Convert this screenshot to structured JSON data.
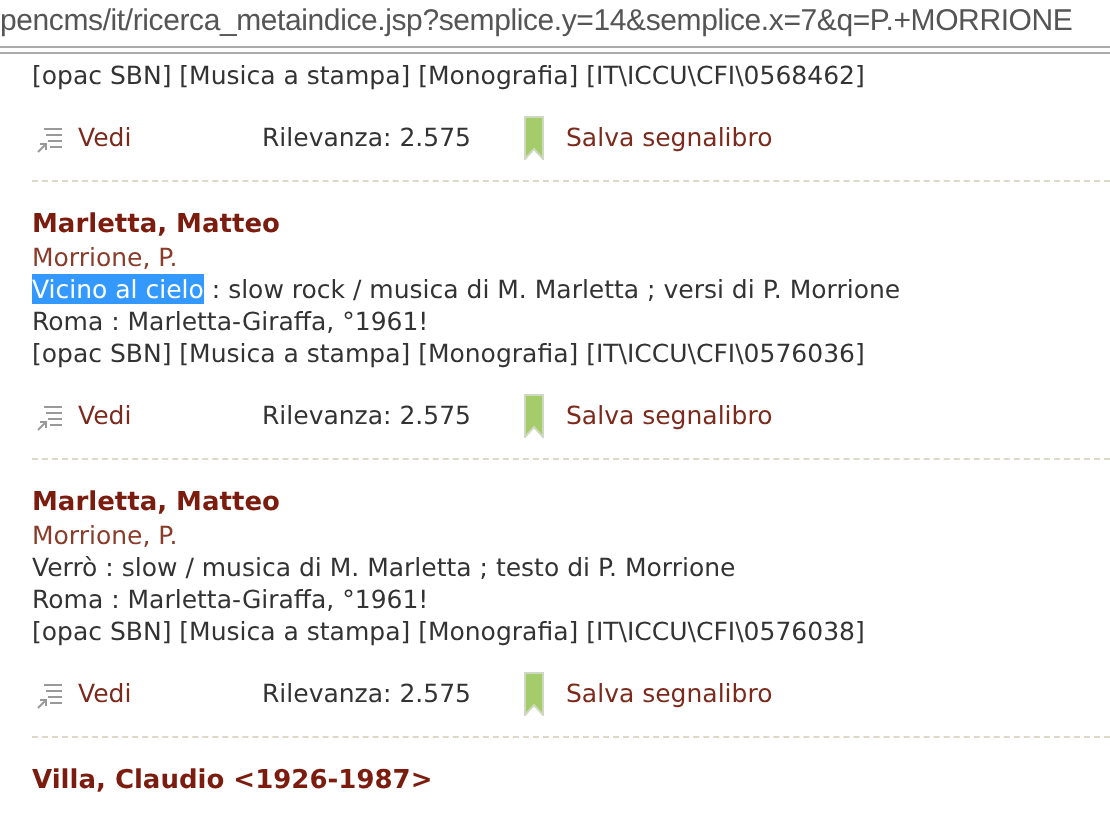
{
  "address_bar": {
    "url": "pencms/it/ricerca_metaindice.jsp?semplice.y=14&semplice.x=7&q=P.+MORRIONE"
  },
  "records": [
    {
      "tags": "[opac SBN] [Musica a stampa] [Monografia] [IT\\ICCU\\CFI\\0568462]",
      "view": "Vedi",
      "relevance": "Rilevanza: 2.575",
      "bookmark": "Salva segnalibro"
    },
    {
      "author": "Marletta, Matteo",
      "co_author": "Morrione, P.",
      "title": [
        {
          "text": "Vicino al cielo",
          "selected": true
        },
        {
          "text": " : slow rock / musica di M. Marletta ; versi di P. Morrione",
          "selected": false
        }
      ],
      "imprint": "Roma : Marletta-Giraffa, °1961!",
      "tags": "[opac SBN] [Musica a stampa] [Monografia] [IT\\ICCU\\CFI\\0576036]",
      "view": "Vedi",
      "relevance": "Rilevanza: 2.575",
      "bookmark": "Salva segnalibro"
    },
    {
      "author": "Marletta, Matteo",
      "co_author": "Morrione, P.",
      "title": [
        {
          "text": "Verrò : slow / musica di M. Marletta ; testo di P. Morrione",
          "selected": false
        }
      ],
      "imprint": "Roma : Marletta-Giraffa, °1961!",
      "tags": "[opac SBN] [Musica a stampa] [Monografia] [IT\\ICCU\\CFI\\0576038]",
      "view": "Vedi",
      "relevance": "Rilevanza: 2.575",
      "bookmark": "Salva segnalibro"
    },
    {
      "author": "Villa, Claudio <1926-1987>"
    }
  ]
}
